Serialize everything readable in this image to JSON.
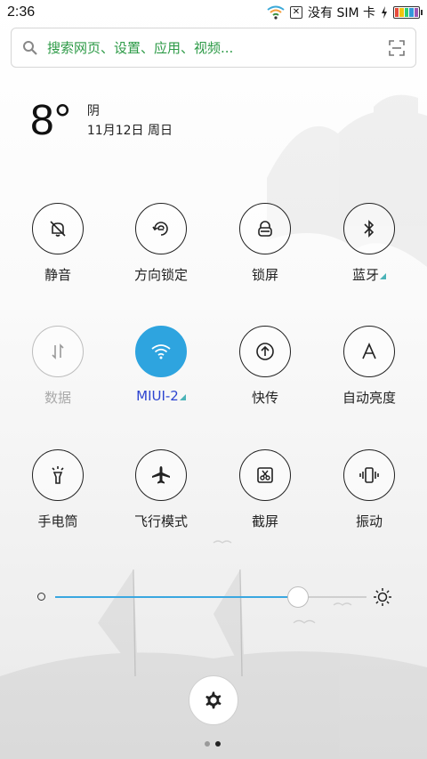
{
  "status_bar": {
    "time": "2:36",
    "carrier": "没有 SIM 卡",
    "icons": [
      "wifi-icon",
      "sim-none-icon",
      "charging-icon",
      "battery-icon"
    ]
  },
  "search": {
    "placeholder": "搜索网页、设置、应用、视频...",
    "icons": [
      "search-icon",
      "scan-icon"
    ]
  },
  "weather": {
    "temperature": "8°",
    "condition": "阴",
    "date": "11月12日 周日"
  },
  "toggles": [
    {
      "label": "静音",
      "icon": "mute-bell-icon",
      "state": "off"
    },
    {
      "label": "方向锁定",
      "icon": "rotation-lock-icon",
      "state": "off"
    },
    {
      "label": "锁屏",
      "icon": "lock-screen-icon",
      "state": "off"
    },
    {
      "label": "蓝牙",
      "icon": "bluetooth-icon",
      "state": "off",
      "has_more": true
    },
    {
      "label": "数据",
      "icon": "mobile-data-icon",
      "state": "disabled"
    },
    {
      "label": "MIUI-2",
      "icon": "wifi-icon",
      "state": "on",
      "has_more": true
    },
    {
      "label": "快传",
      "icon": "fast-transfer-icon",
      "state": "off"
    },
    {
      "label": "自动亮度",
      "icon": "auto-brightness-icon",
      "state": "off"
    },
    {
      "label": "手电筒",
      "icon": "flashlight-icon",
      "state": "off"
    },
    {
      "label": "飞行模式",
      "icon": "airplane-icon",
      "state": "off"
    },
    {
      "label": "截屏",
      "icon": "screenshot-icon",
      "state": "off"
    },
    {
      "label": "振动",
      "icon": "vibrate-icon",
      "state": "off"
    }
  ],
  "brightness": {
    "level": 0.78,
    "icons": [
      "brightness-low-icon",
      "brightness-high-icon"
    ]
  },
  "settings_icon": "gear-icon",
  "pages": {
    "count": 2,
    "current": 2
  },
  "colors": {
    "accent": "#2ea4df",
    "search_text": "#2c9a46",
    "active_label": "#2d44d0",
    "more_indicator": "#4bb3b8"
  }
}
